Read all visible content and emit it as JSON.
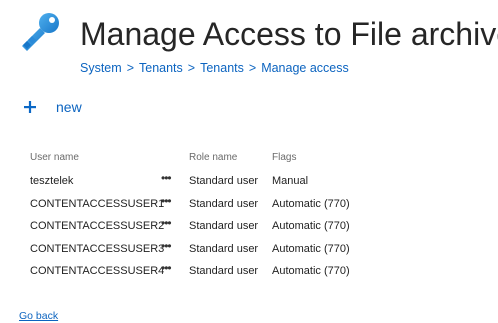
{
  "header": {
    "title": "Manage Access to File archive",
    "icon": "key-icon"
  },
  "breadcrumb": [
    "System",
    "Tenants",
    "Tenants",
    "Manage access"
  ],
  "breadcrumb_separator": ">",
  "toolbar": {
    "new_label": "new",
    "new_icon": "plus-icon"
  },
  "table": {
    "columns": {
      "user": "User name",
      "role": "Role name",
      "flags": "Flags"
    },
    "menu_glyph": "•••",
    "rows": [
      {
        "user": "tesztelek",
        "role": "Standard user",
        "flags": "Manual"
      },
      {
        "user": "CONTENTACCESSUSER1",
        "role": "Standard user",
        "flags": "Automatic (770)"
      },
      {
        "user": "CONTENTACCESSUSER2",
        "role": "Standard user",
        "flags": "Automatic (770)"
      },
      {
        "user": "CONTENTACCESSUSER3",
        "role": "Standard user",
        "flags": "Automatic (770)"
      },
      {
        "user": "CONTENTACCESSUSER4",
        "role": "Standard user",
        "flags": "Automatic (770)"
      }
    ]
  },
  "footer": {
    "go_back": "Go back"
  },
  "colors": {
    "accent": "#0c64c0",
    "icon_blue": "#1e88d6",
    "text": "#262626"
  }
}
